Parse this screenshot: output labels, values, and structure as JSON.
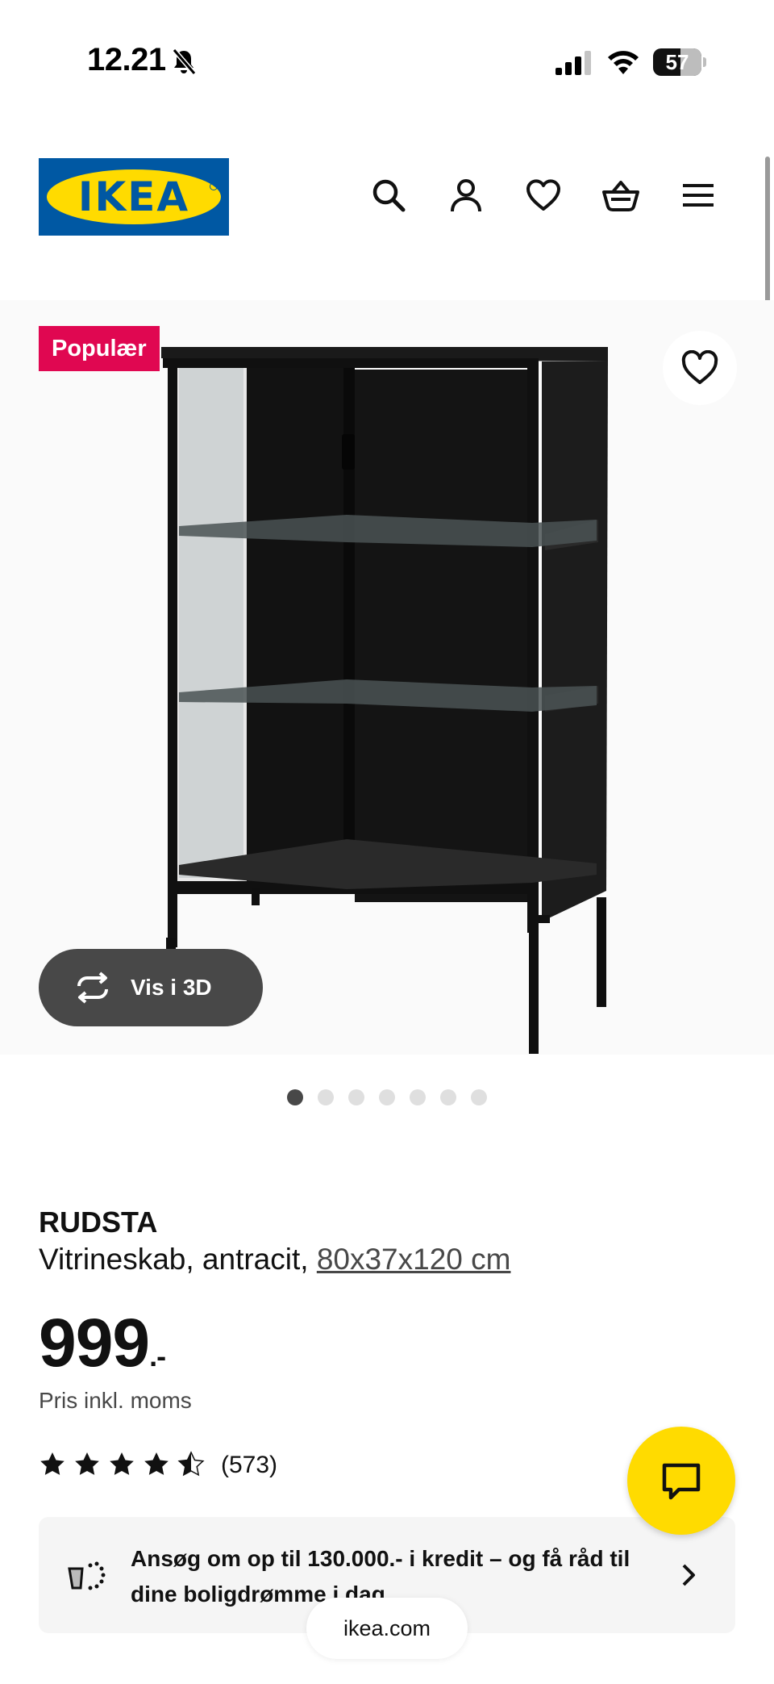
{
  "status_bar": {
    "time": "12.21",
    "battery": "57",
    "battery_level_percent": 57,
    "icons": [
      "bell-slash-icon",
      "cellular-signal-icon",
      "wifi-icon",
      "battery-icon"
    ]
  },
  "header": {
    "logo_text": "IKEA",
    "icons": [
      "search-icon",
      "account-icon",
      "heart-icon",
      "shopping-basket-icon",
      "menu-icon"
    ]
  },
  "gallery": {
    "badge": "Populær",
    "view_3d_label": "Vis i 3D",
    "image_count": 7,
    "active_index": 0
  },
  "product": {
    "name": "RUDSTA",
    "description": "Vitrineskab, antracit, ",
    "dimensions": "80x37x120 cm",
    "price": "999",
    "price_suffix": ".-",
    "price_note": "Pris inkl. moms",
    "rating": 4.5,
    "rating_max": 5,
    "review_count": "(573)"
  },
  "credit_banner": {
    "text": "Ansøg om op til 130.000.- i kredit – og få råd til dine boligdrømme i dag"
  },
  "browser": {
    "url": "ikea.com"
  },
  "colors": {
    "ikea_blue": "#0058a3",
    "ikea_yellow": "#ffdb00",
    "badge_red": "#e00751",
    "dark_grey": "#484848"
  }
}
